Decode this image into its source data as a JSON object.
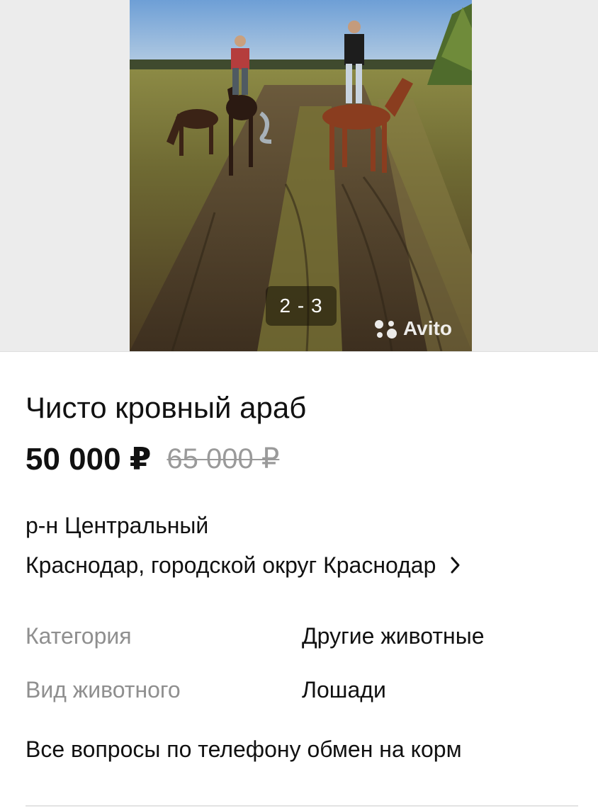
{
  "gallery": {
    "counter": "2 - 3",
    "watermark": "Avito"
  },
  "listing": {
    "title": "Чисто кровный араб",
    "price": "50 000 ₽",
    "old_price": "65 000 ₽"
  },
  "location": {
    "district": "р-н Центральный",
    "address": "Краснодар, городской округ Краснодар",
    "chevron_icon": "chevron-right-icon"
  },
  "params": [
    {
      "label": "Категория",
      "value": "Другие животные"
    },
    {
      "label": "Вид животного",
      "value": "Лошади"
    }
  ],
  "description": "Все вопросы по телефону обмен на корм"
}
